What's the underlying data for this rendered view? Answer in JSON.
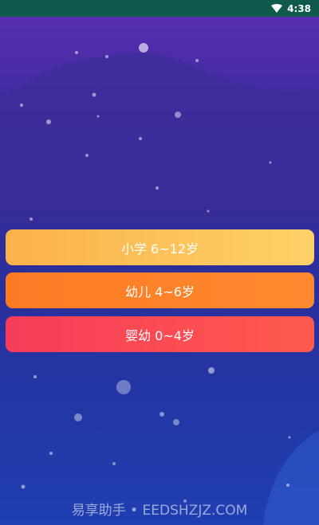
{
  "status_bar": {
    "time": "4:38",
    "icon": "wifi-icon"
  },
  "buttons": [
    {
      "label": "小学 6~12岁"
    },
    {
      "label": "幼儿 4~6岁"
    },
    {
      "label": "婴幼 0~4岁"
    }
  ],
  "watermark": "易享助手 • EEDSHZJZ.COM",
  "colors": {
    "status_bar_bg": "#0f5a4c",
    "btn_primary_start": "#fbb14b",
    "btn_primary_end": "#fed168",
    "btn_orange": "#fd7a23",
    "btn_red_start": "#f73c5a",
    "btn_red_end": "#ff5a4d"
  }
}
